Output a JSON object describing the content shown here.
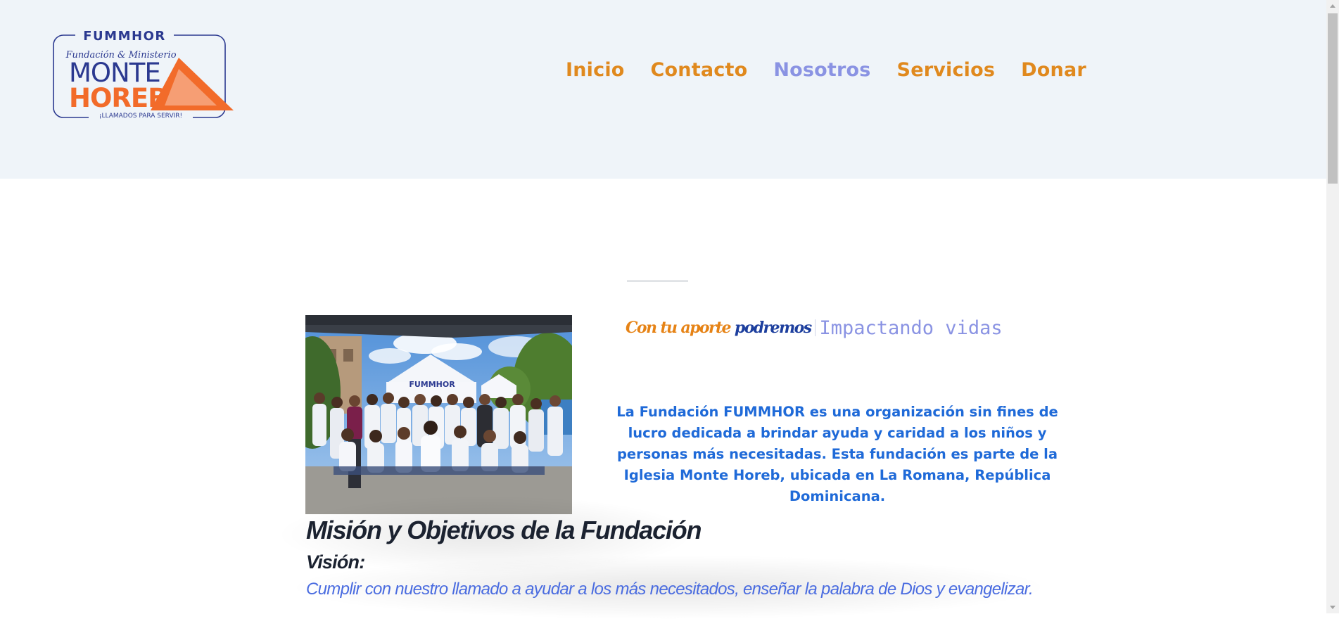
{
  "logo": {
    "top_text": "FUMMHOR",
    "script_text": "Fundación & Ministerio",
    "word1": "MONTE",
    "word2": "HOREB",
    "slogan": "¡LLAMADOS PARA SERVIR!"
  },
  "nav": {
    "items": [
      {
        "label": "Inicio",
        "active": false
      },
      {
        "label": "Contacto",
        "active": false
      },
      {
        "label": "Nosotros",
        "active": true
      },
      {
        "label": "Servicios",
        "active": false
      },
      {
        "label": "Donar",
        "active": false
      }
    ]
  },
  "hero": {
    "photo_banner_text": "FUMMHOR",
    "tagline_part1": "Con tu aporte",
    "tagline_part2": "podremos",
    "tagline_typed": "Impactando vidas",
    "about": "La Fundación FUMMHOR es una organización sin fines de lucro dedicada a brindar ayuda y caridad a los niños y personas más necesitadas. Esta fundación es parte de la Iglesia Monte Horeb, ubicada en La Romana, República Dominicana."
  },
  "mision": {
    "title": "Misión y Objetivos de la Fundación",
    "vision_label": "Visión:",
    "vision_text": "Cumplir con nuestro llamado a ayudar a los más necesitados, enseñar la palabra de Dios y evangelizar."
  },
  "colors": {
    "header_bg": "#eff4f9",
    "nav_orange": "#e0891e",
    "nav_active": "#8a93e3",
    "about_blue": "#1f6ad8",
    "logo_navy": "#2b3990",
    "logo_orange": "#f26b2a"
  },
  "icons": {
    "scroll_up": "triangle-up-icon",
    "scroll_down": "triangle-down-icon"
  }
}
